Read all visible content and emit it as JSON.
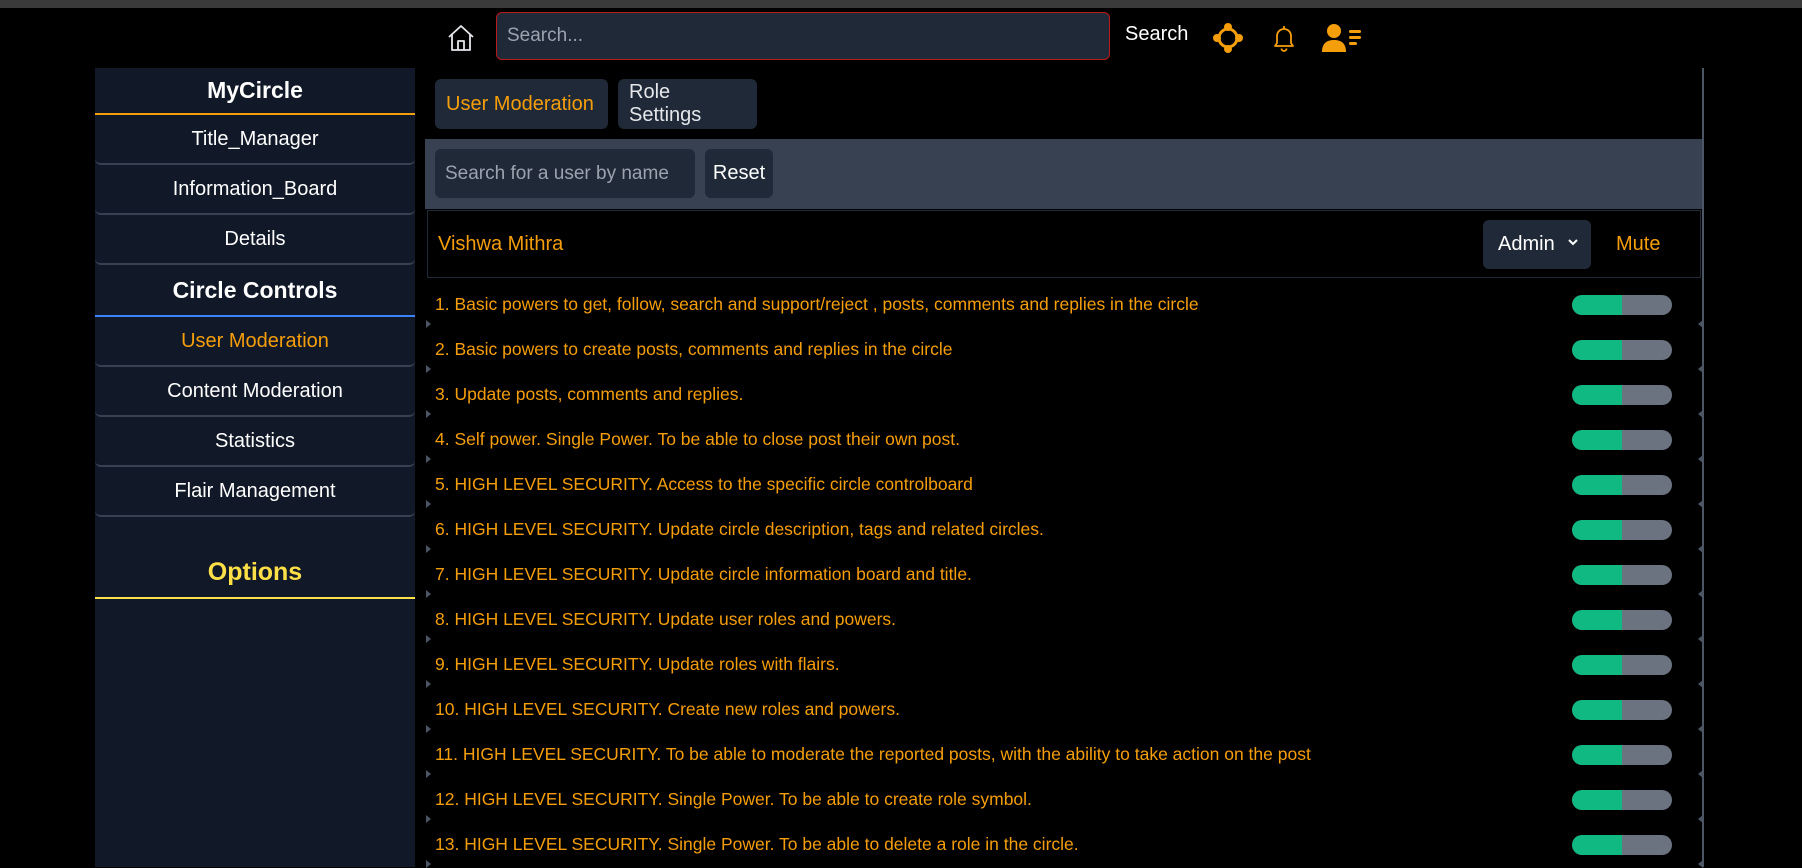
{
  "header": {
    "search_placeholder": "Search...",
    "search_button": "Search"
  },
  "sidebar": {
    "title": "MyCircle",
    "items_top": [
      {
        "label": "Title_Manager"
      },
      {
        "label": "Information_Board"
      },
      {
        "label": "Details"
      }
    ],
    "controls_heading": "Circle Controls",
    "items_controls": [
      {
        "label": "User Moderation",
        "active": true
      },
      {
        "label": "Content Moderation"
      },
      {
        "label": "Statistics"
      },
      {
        "label": "Flair Management"
      }
    ],
    "options_heading": "Options"
  },
  "tabs": [
    {
      "label": "User Moderation",
      "active": true
    },
    {
      "label": "Role Settings"
    }
  ],
  "filter": {
    "user_search_placeholder": "Search for a user by name",
    "reset_label": "Reset"
  },
  "user": {
    "name": "Vishwa Mithra",
    "role": "Admin",
    "mute_label": "Mute"
  },
  "powers": [
    {
      "text": "1. Basic powers to get, follow, search and support/reject , posts, comments and replies in the circle",
      "enabled_fraction": 0.5
    },
    {
      "text": "2. Basic powers to create posts, comments and replies in the circle",
      "enabled_fraction": 0.5
    },
    {
      "text": "3. Update posts, comments and replies.",
      "enabled_fraction": 0.5
    },
    {
      "text": "4. Self power. Single Power. To be able to close post their own post.",
      "enabled_fraction": 0.5
    },
    {
      "text": "5. HIGH LEVEL SECURITY. Access to the specific circle controlboard",
      "enabled_fraction": 0.5
    },
    {
      "text": "6. HIGH LEVEL SECURITY. Update circle description, tags and related circles.",
      "enabled_fraction": 0.5
    },
    {
      "text": "7. HIGH LEVEL SECURITY. Update circle information board and title.",
      "enabled_fraction": 0.5
    },
    {
      "text": "8. HIGH LEVEL SECURITY. Update user roles and powers.",
      "enabled_fraction": 0.5
    },
    {
      "text": "9. HIGH LEVEL SECURITY. Update roles with flairs.",
      "enabled_fraction": 0.5
    },
    {
      "text": "10. HIGH LEVEL SECURITY. Create new roles and powers.",
      "enabled_fraction": 0.5
    },
    {
      "text": "11. HIGH LEVEL SECURITY. To be able to moderate the reported posts, with the ability to take action on the post",
      "enabled_fraction": 0.5
    },
    {
      "text": "12. HIGH LEVEL SECURITY. Single Power. To be able to create role symbol.",
      "enabled_fraction": 0.5
    },
    {
      "text": "13. HIGH LEVEL SECURITY. Single Power. To be able to delete a role in the circle.",
      "enabled_fraction": 0.5
    }
  ],
  "icons": {
    "home": "home-icon",
    "circles": "circles-network-icon",
    "notifications": "bell-icon",
    "profile": "user-menu-icon",
    "dropdown": "chevron-down-icon"
  },
  "colors": {
    "accent_orange": "#f59e0b",
    "accent_yellow": "#fde047",
    "toggle_on": "#10b981",
    "toggle_off": "#6b7280",
    "sidebar_bg": "#111827",
    "panel_bg": "#1f2937",
    "band_bg": "#374151",
    "search_border": "#b91c1c"
  }
}
